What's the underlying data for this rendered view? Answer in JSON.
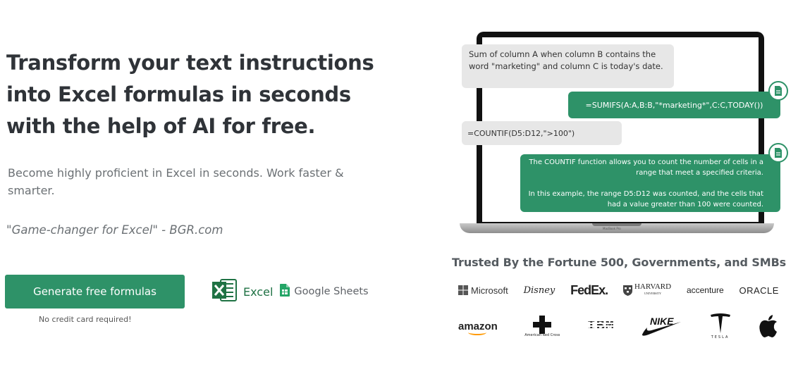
{
  "hero": {
    "headline_lines": [
      "Transform your text instructions",
      "into Excel formulas in seconds",
      "with the help of AI for free."
    ],
    "subheadline": "Become highly proficient in Excel in seconds. Work faster & smarter.",
    "quote": "\"Game-changer for Excel\" - BGR.com",
    "cta_label": "Generate free formulas",
    "cta_note": "No credit card required!",
    "apps": {
      "excel_label": "Excel",
      "sheets_label": "Google Sheets"
    }
  },
  "chat": {
    "user_prompt_1": "Sum of column A when column B contains the word \"marketing\" and column C is today's date.",
    "bot_reply_1": "=SUMIFS(A:A,B:B,\"*marketing*\",C:C,TODAY())",
    "user_prompt_2": "=COUNTIF(D5:D12,\">100\")",
    "bot_reply_2_p1": "The COUNTIF function allows you to count the number of cells in a range that meet a specified criteria.",
    "bot_reply_2_p2": "In this example, the range D5:D12 was counted, and the cells that had a value greater than 100 were counted.",
    "laptop_brand": "MacBook Pro"
  },
  "trusted": {
    "title": "Trusted By the Fortune 500, Governments, and SMBs",
    "logos_row1": {
      "microsoft": "Microsoft",
      "disney": "Disney",
      "fedex_fed": "Fed",
      "fedex_ex": "Ex.",
      "harvard": "HARVARD",
      "harvard_sub": "UNIVERSITY",
      "accenture": "accenture",
      "oracle": "ORACLE"
    },
    "logos_row2": {
      "amazon": "amazon",
      "redcross": "American Red Cross",
      "ibm": "IBM",
      "nike": "NIKE",
      "tesla": "TESLA",
      "apple": "apple-logo"
    }
  },
  "colors": {
    "brand_green": "#2e9268",
    "headline": "#2f3338",
    "body_text": "#6b7074",
    "user_bubble": "#e7e7e7"
  }
}
